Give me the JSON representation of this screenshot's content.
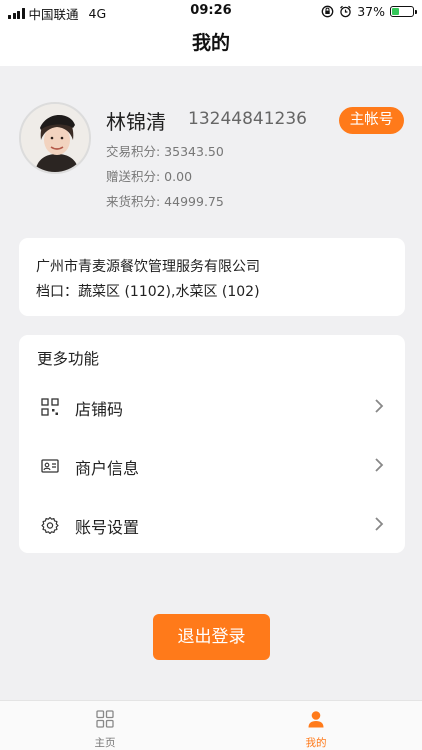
{
  "status_bar": {
    "carrier": "中国联通",
    "network": "4G",
    "time": "09:26",
    "battery_percent": "37%",
    "battery_level": 0.37,
    "icons": [
      "signal-icon",
      "orientation-lock-icon",
      "alarm-icon",
      "battery-charging-icon"
    ]
  },
  "header": {
    "title": "我的"
  },
  "profile": {
    "name": "林锦清",
    "phone": "13244841236",
    "badge": "主帐号",
    "trade_points": "交易积分: 35343.50",
    "gift_points": "赠送积分: 0.00",
    "goods_points": "来货积分: 44999.75"
  },
  "company": {
    "name": "广州市青麦源餐饮管理服务有限公司",
    "stalls": "档口：蔬菜区 (1102),水菜区 (102)"
  },
  "functions": {
    "title": "更多功能",
    "items": [
      {
        "label": "店铺码",
        "icon": "qrcode-icon"
      },
      {
        "label": "商户信息",
        "icon": "id-card-icon"
      },
      {
        "label": "账号设置",
        "icon": "gear-icon"
      }
    ]
  },
  "logout_label": "退出登录",
  "tabbar": {
    "tabs": [
      {
        "label": "主页",
        "icon": "grid-icon",
        "active": false
      },
      {
        "label": "我的",
        "icon": "person-icon",
        "active": true
      }
    ]
  },
  "colors": {
    "accent": "#ff7a1a",
    "background": "#f0f0f2",
    "card": "#ffffff"
  }
}
